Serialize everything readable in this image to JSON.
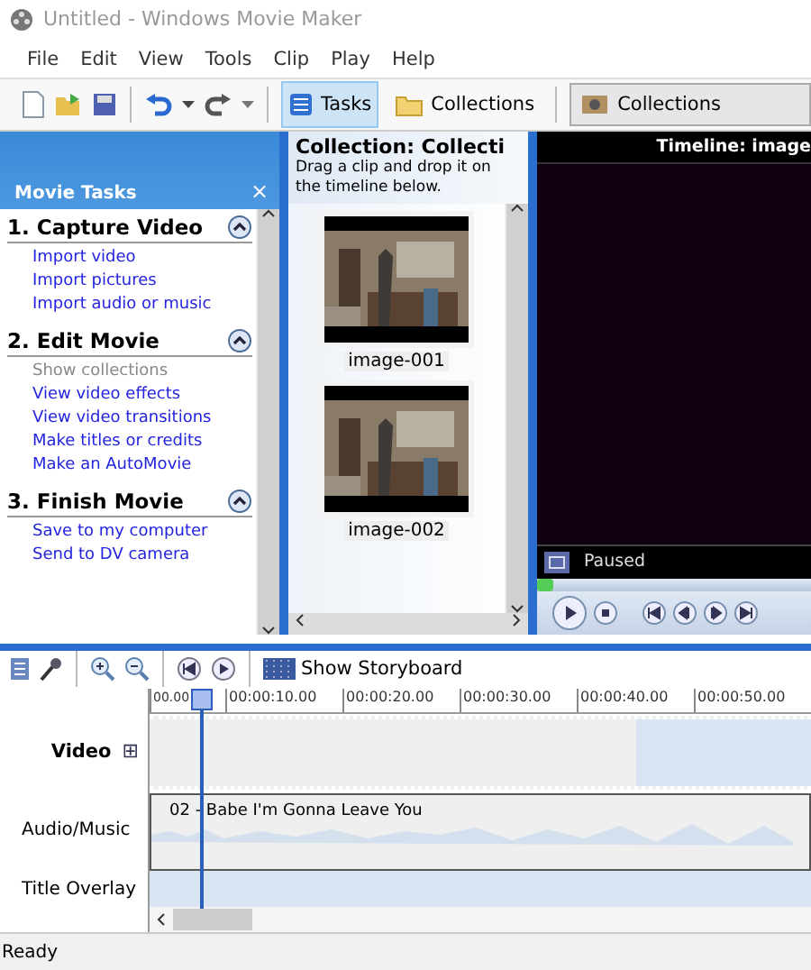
{
  "window": {
    "title": "Untitled - Windows Movie Maker"
  },
  "menu": [
    "File",
    "Edit",
    "View",
    "Tools",
    "Clip",
    "Play",
    "Help"
  ],
  "toolbar": {
    "buttons": [
      {
        "label": "Tasks",
        "selected": true
      },
      {
        "label": "Collections",
        "selected": false
      }
    ],
    "collection_dropdown": "Collections"
  },
  "task_pane": {
    "title": "Movie Tasks",
    "close": "×",
    "sections": [
      {
        "title": "1. Capture Video",
        "items": [
          {
            "label": "Import video",
            "disabled": false
          },
          {
            "label": "Import pictures",
            "disabled": false
          },
          {
            "label": "Import audio or music",
            "disabled": false
          }
        ]
      },
      {
        "title": "2. Edit Movie",
        "items": [
          {
            "label": "Show collections",
            "disabled": true
          },
          {
            "label": "View video effects",
            "disabled": false
          },
          {
            "label": "View video transitions",
            "disabled": false
          },
          {
            "label": "Make titles or credits",
            "disabled": false
          },
          {
            "label": "Make an AutoMovie",
            "disabled": false
          }
        ]
      },
      {
        "title": "3. Finish Movie",
        "items": [
          {
            "label": "Save to my computer",
            "disabled": false
          },
          {
            "label": "Send to DV camera",
            "disabled": false
          }
        ]
      }
    ]
  },
  "collection": {
    "title": "Collection: Collecti",
    "hint": "Drag a clip and drop it on the timeline below.",
    "clips": [
      {
        "name": "image-001",
        "kind": "picture"
      },
      {
        "name": "image-002",
        "kind": "picture"
      }
    ]
  },
  "preview": {
    "title": "Timeline: image",
    "status": "Paused",
    "level": 0.06
  },
  "timeline": {
    "storyboard_button": "Show Storyboard",
    "ruler": [
      "00.00",
      "00:00:10.00",
      "00:00:20.00",
      "00:00:30.00",
      "00:00:40.00",
      "00:00:50.00"
    ],
    "tracks": [
      {
        "kind": "video",
        "label": "Video",
        "expand": "⊞"
      },
      {
        "kind": "audio",
        "label": "Audio/Music",
        "clip": "02 - Babe I'm Gonna Leave You"
      },
      {
        "kind": "overlay",
        "label": "Title Overlay"
      }
    ]
  },
  "status_bar": "Ready"
}
